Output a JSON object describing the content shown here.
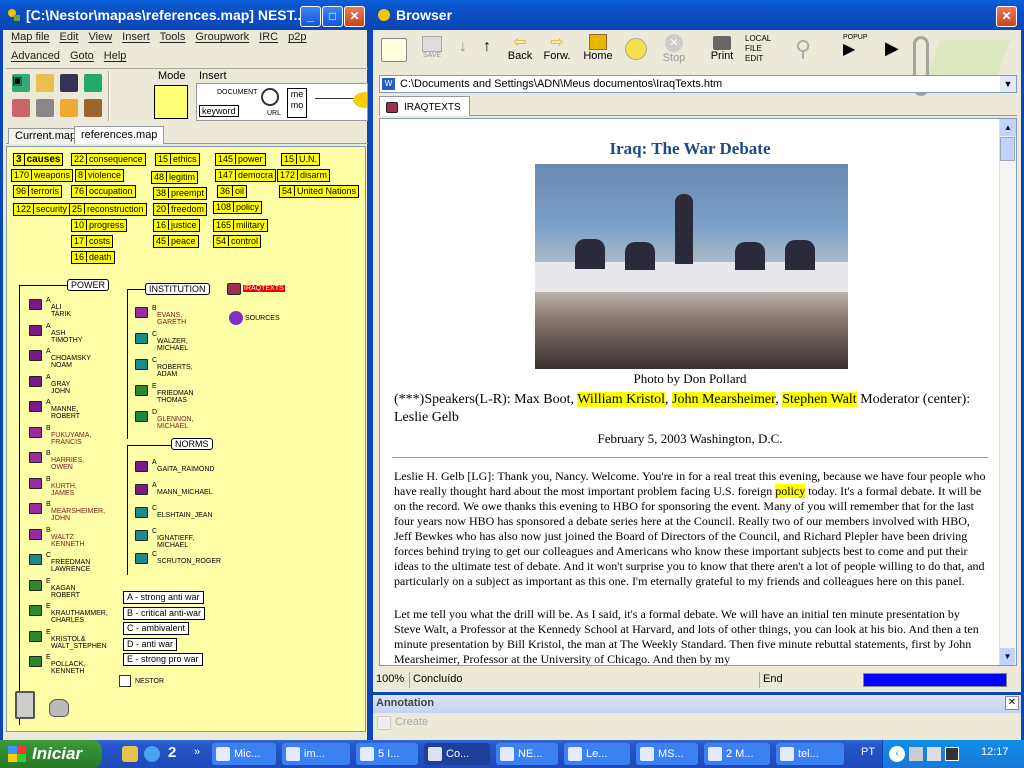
{
  "left_window": {
    "title": "[C:\\Nestor\\mapas\\references.map] NEST...",
    "menu_row1": [
      "Map file",
      "Edit",
      "View",
      "Insert",
      "Tools",
      "Groupwork",
      "IRC",
      "p2p"
    ],
    "menu_row2": [
      "Advanced",
      "Goto",
      "Help"
    ],
    "mode_label": "Mode",
    "insert_label": "Insert",
    "insert_items": {
      "document": "DOCUMENT",
      "keyword": "keyword",
      "url": "URL",
      "memo": "me mo"
    },
    "tabs": [
      "Current.map",
      "references.map"
    ],
    "keywords": [
      {
        "n": "3",
        "w": "causes"
      },
      {
        "n": "22",
        "w": "consequence"
      },
      {
        "n": "15",
        "w": "ethics"
      },
      {
        "n": "145",
        "w": "power"
      },
      {
        "n": "15",
        "w": "U.N."
      },
      {
        "n": "170",
        "w": "weapons"
      },
      {
        "n": "8",
        "w": "violence"
      },
      {
        "n": "48",
        "w": "legitim"
      },
      {
        "n": "147",
        "w": "democra"
      },
      {
        "n": "172",
        "w": "disarm"
      },
      {
        "n": "96",
        "w": "terroris"
      },
      {
        "n": "76",
        "w": "occupation"
      },
      {
        "n": "38",
        "w": "preempt"
      },
      {
        "n": "36",
        "w": "oil"
      },
      {
        "n": "54",
        "w": "United Nations"
      },
      {
        "n": "122",
        "w": "security"
      },
      {
        "n": "25",
        "w": "reconstruction"
      },
      {
        "n": "20",
        "w": "freedom"
      },
      {
        "n": "108",
        "w": "policy"
      },
      {
        "n": "10",
        "w": "progress"
      },
      {
        "n": "16",
        "w": "justice"
      },
      {
        "n": "165",
        "w": "military"
      },
      {
        "n": "17",
        "w": "costs"
      },
      {
        "n": "45",
        "w": "peace"
      },
      {
        "n": "54",
        "w": "control"
      },
      {
        "n": "16",
        "w": "death"
      }
    ],
    "groups": {
      "power": "POWER",
      "institution": "INSTITUTION",
      "norms": "NORMS"
    },
    "power_nodes": [
      {
        "grade": "A",
        "name": "ALI\nTARIK"
      },
      {
        "grade": "A",
        "name": "ASH\nTIMOTHY"
      },
      {
        "grade": "A",
        "name": "CHOAMSKY\nNOAM"
      },
      {
        "grade": "A",
        "name": "GRAY\nJOHN"
      },
      {
        "grade": "A",
        "name": "MANNE,\nROBERT"
      },
      {
        "grade": "B",
        "name": "FUKUYAMA,\nFRANCIS"
      },
      {
        "grade": "B",
        "name": "HARRIES,\nOWEN"
      },
      {
        "grade": "B",
        "name": "KURTH,\nJAMES"
      },
      {
        "grade": "B",
        "name": "MEARSHEIMER,\nJOHN"
      },
      {
        "grade": "B",
        "name": "WALTZ\nKENNETH"
      },
      {
        "grade": "C",
        "name": "FREEDMAN\nLAWRENCE"
      },
      {
        "grade": "E",
        "name": "KAGAN\nROBERT"
      },
      {
        "grade": "E",
        "name": "KRAUTHAMMER,\nCHARLES"
      },
      {
        "grade": "E",
        "name": "KRISTOL&\nWALT_STEPHEN"
      },
      {
        "grade": "E",
        "name": "POLLACK,\nKENNETH"
      }
    ],
    "institution_nodes": [
      {
        "grade": "B",
        "name": "EVANS,\nGARETH"
      },
      {
        "grade": "C",
        "name": "WALZER,\nMICHAEL"
      },
      {
        "grade": "C",
        "name": "ROBERTS,\nADAM"
      },
      {
        "grade": "E",
        "name": "FRIEDMAN\nTHOMAS"
      },
      {
        "grade": "D",
        "name": "GLENNON,\nMICHAEL"
      }
    ],
    "norms_nodes": [
      {
        "grade": "A",
        "name": "GAITA_RAIMOND"
      },
      {
        "grade": "A",
        "name": "MANN_MICHAEL"
      },
      {
        "grade": "C",
        "name": "ELSHTAIN_JEAN"
      },
      {
        "grade": "C",
        "name": "IGNATIEFF,\nMICHAEL"
      },
      {
        "grade": "C",
        "name": "SCRUTON_ROGER"
      }
    ],
    "iraqtexts": "IRAQTEXTS",
    "sources": "SOURCES",
    "legend": [
      "A - strong anti war",
      "B - critical anti-war",
      "C - ambivalent",
      "D - anti war",
      "E - strong pro war"
    ],
    "nestor_label": "NESTOR"
  },
  "browser": {
    "title": "Browser",
    "toolbar": {
      "save": "SAVE",
      "back": "Back",
      "forward": "Forw.",
      "home": "Home",
      "stop": "Stop",
      "print": "Print",
      "local": "LOCAL\nFILE\nEDIT",
      "popup": "POPUP"
    },
    "address": "C:\\Documents and Settings\\ADN\\Meus documentos\\IraqTexts.htm",
    "tab": "IRAQTEXTS",
    "page": {
      "heading": "Iraq: The War Debate",
      "photo_credit": "Photo by Don Pollard",
      "speakers_prefix": "(***)Speakers(L-R): Max Boot,",
      "speaker1": "William Kristol",
      "sep1": ",",
      "speaker2": "John Mearsheimer",
      "sep2": ",",
      "speaker3": "Stephen Walt",
      "moderator": "Moderator (center): Leslie Gelb",
      "date_place": "February 5, 2003 Washington, D.C.",
      "para1_a": "Leslie H. Gelb [LG]: Thank you, Nancy. Welcome. You're in for a real treat this evening, because we have four people who have really thought hard about the most important problem facing U.S. foreign",
      "para1_hl": "policy",
      "para1_b": "today. It's a formal debate. It will be on the record. We owe thanks this evening to HBO for sponsoring the event. Many of you will remember that for the last four years now HBO has sponsored a debate series here at the Council. Really two of our members involved with HBO, Jeff Bewkes who has also now just joined the Board of Directors of the Council, and Richard Plepler have been driving forces behind trying to get our colleagues and Americans who know these important subjects best to come and put their ideas to the ultimate test of debate. And it won't surprise you to know that there aren't a lot of people willing to do that, and particularly on a subject as important as this one. I'm eternally grateful to my friends and colleagues here on this panel.",
      "para2": "Let me tell you what the drill will be. As I said, it's a formal debate. We will have an initial ten minute presentation by Steve Walt, a Professor at the Kennedy School at Harvard, and lots of other things, you can look at his bio. And then a ten minute presentation by Bill Kristol, the man at The Weekly Standard. Then five minute rebuttal statements, first by John Mearsheimer, Professor at the University of Chicago. And then by my"
    },
    "status": {
      "zoom": "100%",
      "state": "Concluído",
      "end": "End"
    }
  },
  "annotation": {
    "title": "Annotation",
    "create": "Create"
  },
  "taskbar": {
    "start": "Iniciar",
    "quick_count": "2",
    "items": [
      "Mic...",
      "im...",
      "5 I...",
      "Co...",
      "NE...",
      "Le...",
      "MS...",
      "2 M...",
      "tel..."
    ],
    "lang": "PT",
    "clock": "12:17"
  }
}
